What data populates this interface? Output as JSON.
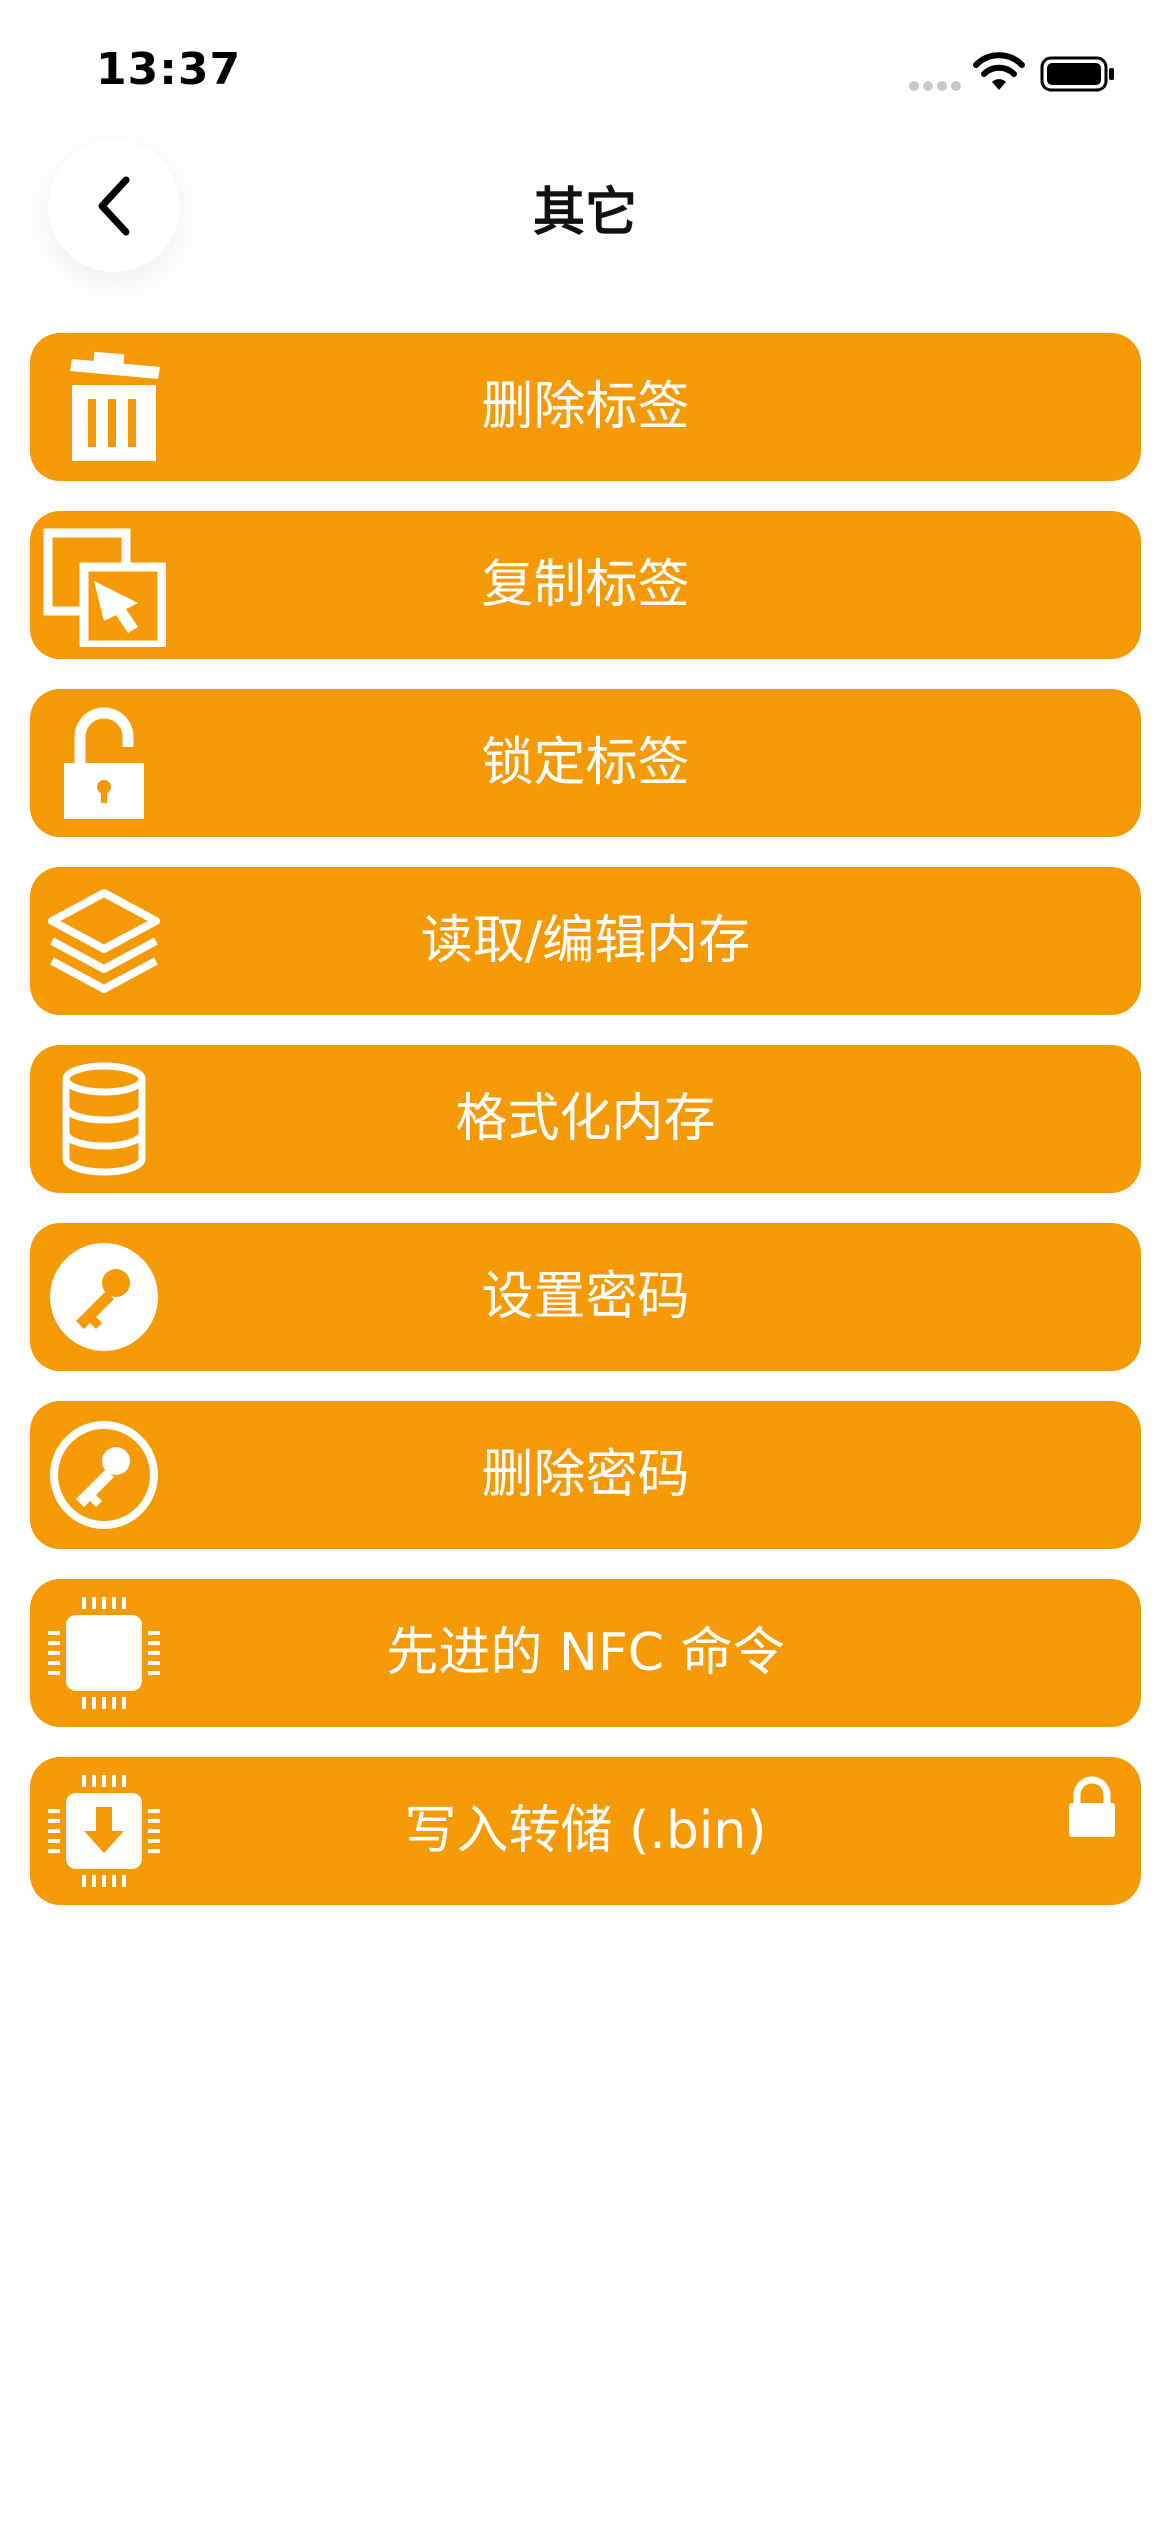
{
  "status_bar": {
    "time": "13:37"
  },
  "header": {
    "title": "其它",
    "back_icon": "chevron-left-icon"
  },
  "menu": {
    "accent_color": "#f59a05",
    "items": [
      {
        "label": "删除标签",
        "icon": "trash-icon"
      },
      {
        "label": "复制标签",
        "icon": "copy-icon"
      },
      {
        "label": "锁定标签",
        "icon": "unlock-icon"
      },
      {
        "label": "读取/编辑内存",
        "icon": "layers-icon"
      },
      {
        "label": "格式化内存",
        "icon": "database-icon"
      },
      {
        "label": "设置密码",
        "icon": "key-filled-circle-icon"
      },
      {
        "label": "删除密码",
        "icon": "key-outline-circle-icon"
      },
      {
        "label": "先进的 NFC 命令",
        "icon": "chip-icon"
      },
      {
        "label": "写入转储 (.bin)",
        "icon": "chip-download-icon",
        "badge_icon": "lock-icon"
      }
    ]
  }
}
